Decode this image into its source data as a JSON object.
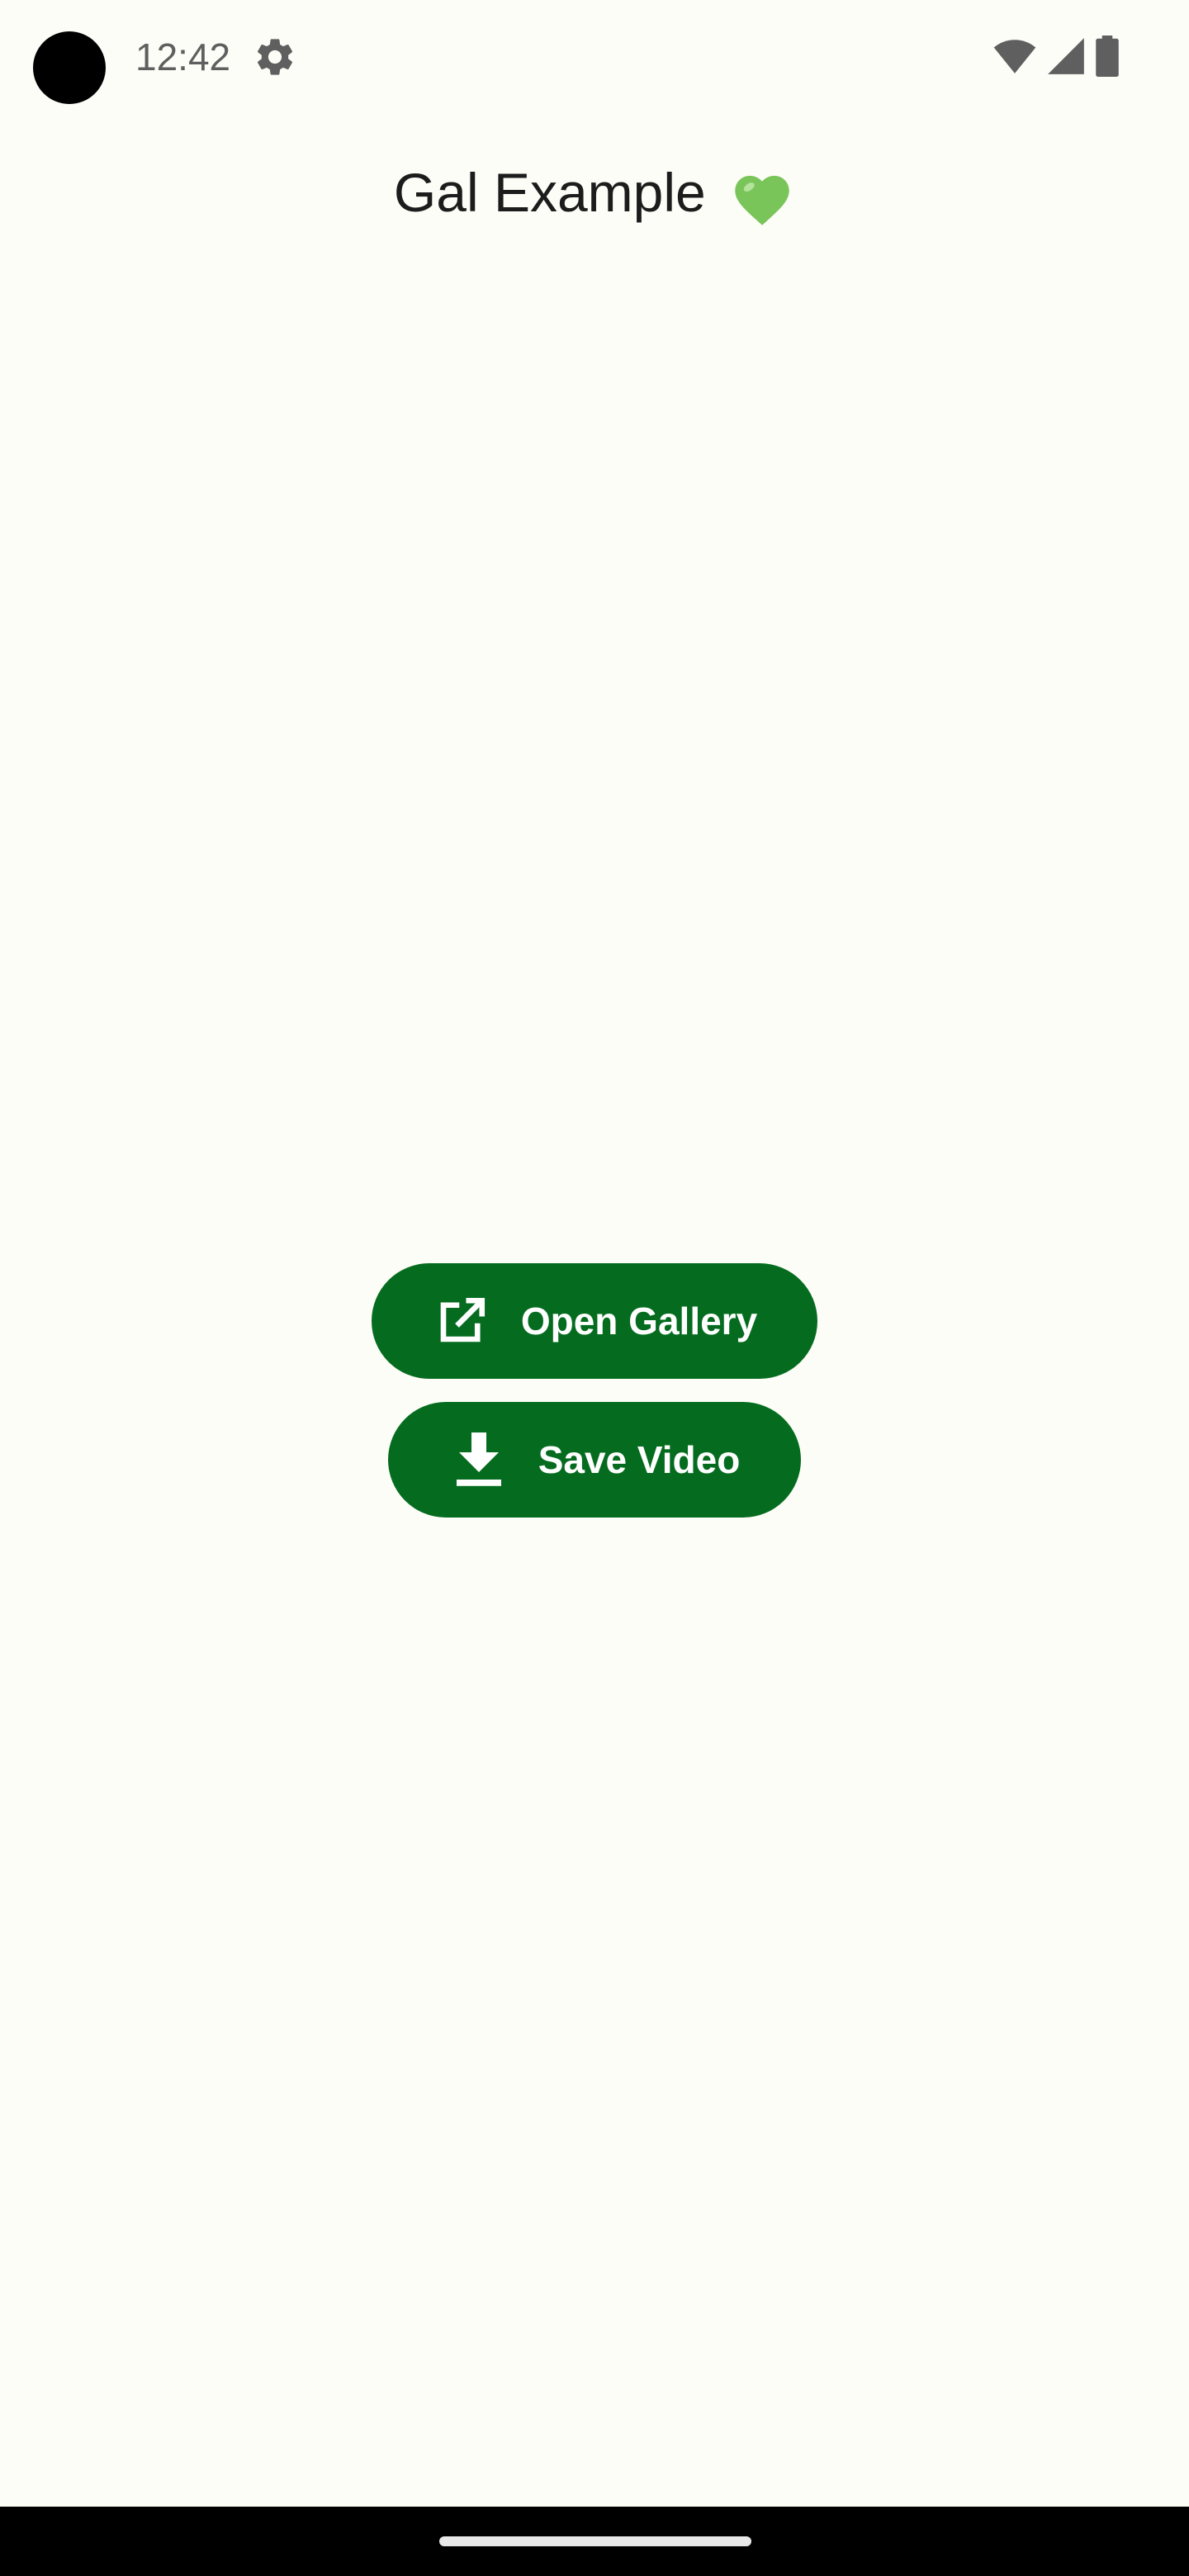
{
  "status_bar": {
    "time": "12:42",
    "icons": [
      "settings-icon",
      "wifi-icon",
      "cellular-signal-icon",
      "battery-icon"
    ]
  },
  "app": {
    "title": "Gal Example",
    "title_emoji": "green-heart-icon"
  },
  "buttons": {
    "open_gallery": {
      "label": "Open Gallery",
      "icon": "open-in-new-icon"
    },
    "save_video": {
      "label": "Save Video",
      "icon": "download-icon"
    }
  },
  "colors": {
    "background": "#fdfdf7",
    "button_fill": "#056c1f",
    "button_text": "#ffffff",
    "heart": "#7ac55a"
  }
}
